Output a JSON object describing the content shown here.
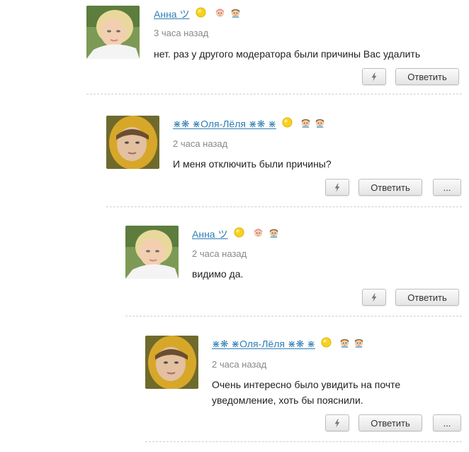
{
  "comments": [
    {
      "author": "Анна ツ",
      "time": "3 часа назад",
      "text": "нет. раз у другого модератора были причины Вас удалить",
      "reply_label": "Ответить",
      "badges": [
        "sun-icon",
        "girl-face-icon",
        "boy-face-icon"
      ],
      "avatar": "avatar-blonde-girl"
    },
    {
      "author": "⋇❋ ⋇Оля-Лёля ⋇❋ ⋇",
      "time": "2 часа назад",
      "text": "И меня отключить были причины?",
      "reply_label": "Ответить",
      "more_label": "...",
      "badges": [
        "sun-icon",
        "boy-face-icon",
        "boy-face-icon"
      ],
      "avatar": "avatar-yellow-hood-girl"
    },
    {
      "author": "Анна ツ",
      "time": "2 часа назад",
      "text": "видимо да.",
      "reply_label": "Ответить",
      "badges": [
        "sun-icon",
        "girl-face-icon",
        "boy-face-icon"
      ],
      "avatar": "avatar-blonde-girl"
    },
    {
      "author": "⋇❋ ⋇Оля-Лёля ⋇❋ ⋇",
      "time": "2 часа назад",
      "text_line1": "Очень интересно было увидить на почте",
      "text_line2": "уведомление, хоть бы пояснили.",
      "reply_label": "Ответить",
      "more_label": "...",
      "badges": [
        "sun-icon",
        "boy-face-icon",
        "boy-face-icon"
      ],
      "avatar": "avatar-yellow-hood-girl"
    }
  ],
  "colors": {
    "link": "#2f7fb6",
    "muted": "#888888",
    "divider": "#cfcfcf"
  }
}
